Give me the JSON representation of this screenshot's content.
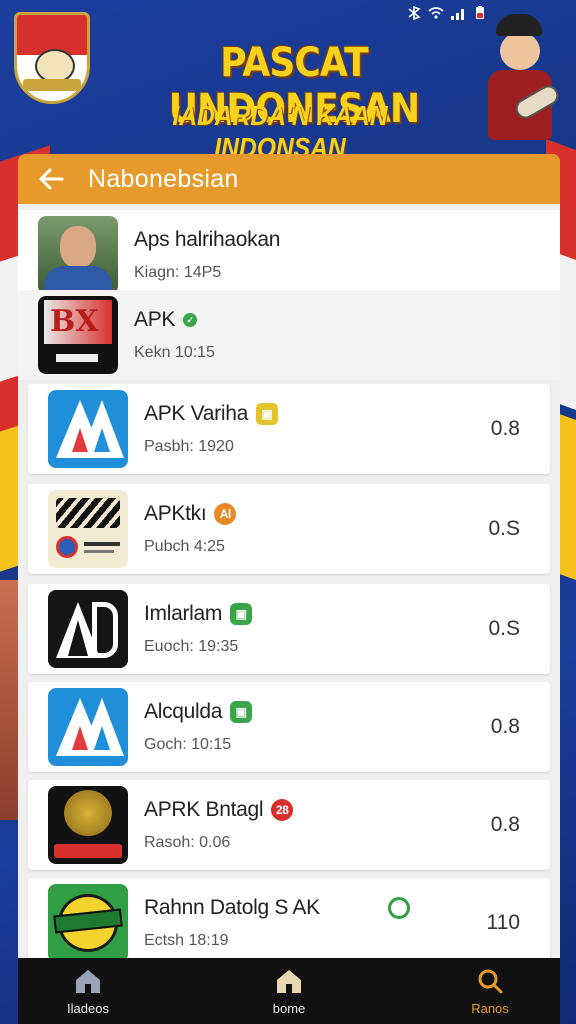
{
  "header": {
    "title": "PASCAT UNDONESAN",
    "subtitle": "IADARDA'N KAAN INDONSAN"
  },
  "app_bar": {
    "title": "Nabonebsian",
    "back_icon": "arrow-left-icon"
  },
  "colors": {
    "accent": "#e79a2c",
    "nav_bg": "#111111",
    "brand_blue": "#1b3d9c",
    "title_yellow": "#f7d21c"
  },
  "apps": [
    {
      "name": "Aps halrihaokan",
      "meta": "Kiagn: 14P5",
      "value": "",
      "badge": ""
    },
    {
      "name": "APK",
      "meta": "Kekn  10:15",
      "value": "",
      "badge": ""
    },
    {
      "name": "APK Variha",
      "meta": "Pasbh: 1920",
      "value": "0.8",
      "badge": ""
    },
    {
      "name": "APKtkı",
      "meta": "Pubch   4:25",
      "value": "0.S",
      "badge": "Al"
    },
    {
      "name": "Imlarlam",
      "meta": "Euoch: 19:35",
      "value": "0.S",
      "badge": ""
    },
    {
      "name": "Alcqulda",
      "meta": "Goch:  10:15",
      "value": "0.8",
      "badge": ""
    },
    {
      "name": "APRK Bntagl",
      "meta": "Rasoh: 0.06",
      "value": "0.8",
      "badge": "28"
    },
    {
      "name": "Rahnn Datolg S AK",
      "meta": "Ectsh  18:19",
      "value": "110",
      "badge": ""
    }
  ],
  "bottom_nav": [
    {
      "label": "Iladeos",
      "icon": "home-icon"
    },
    {
      "label": "bome",
      "icon": "home-icon"
    },
    {
      "label": "Ranos",
      "icon": "search-icon"
    }
  ]
}
